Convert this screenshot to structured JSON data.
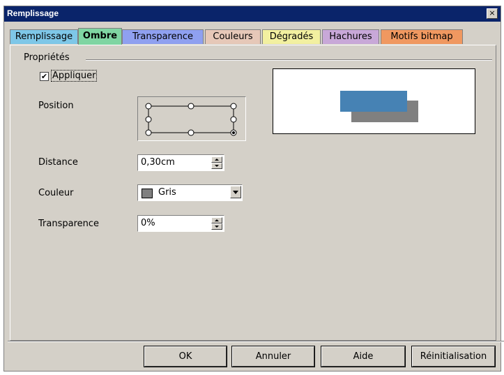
{
  "window": {
    "title": "Remplissage",
    "close_glyph": "×"
  },
  "tabs": [
    {
      "label": "Remplissage",
      "color": "#7ec7e8",
      "active": false
    },
    {
      "label": "Ombre",
      "color": "#7fd5a2",
      "active": true
    },
    {
      "label": "Transparence",
      "color": "#8fa0f0",
      "active": false
    },
    {
      "label": "Couleurs",
      "color": "#e6c8b8",
      "active": false
    },
    {
      "label": "Dégradés",
      "color": "#f2f0a0",
      "active": false
    },
    {
      "label": "Hachures",
      "color": "#c8a8d8",
      "active": false
    },
    {
      "label": "Motifs bitmap",
      "color": "#f09860",
      "active": false
    }
  ],
  "properties": {
    "section_title": "Propriétés",
    "apply": {
      "label": "Appliquer",
      "checked": true,
      "check_glyph": "✔"
    },
    "position": {
      "label": "Position",
      "selected": "bottom-right"
    },
    "distance": {
      "label": "Distance",
      "value": "0,30cm"
    },
    "color": {
      "label": "Couleur",
      "value": "Gris",
      "swatch": "#808080"
    },
    "transparency": {
      "label": "Transparence",
      "value": "0%"
    }
  },
  "preview": {
    "shape_color": "#4682b4",
    "shadow_color": "#808080"
  },
  "buttons": {
    "ok": "OK",
    "cancel": "Annuler",
    "help": "Aide",
    "reset": "Réinitialisation"
  }
}
